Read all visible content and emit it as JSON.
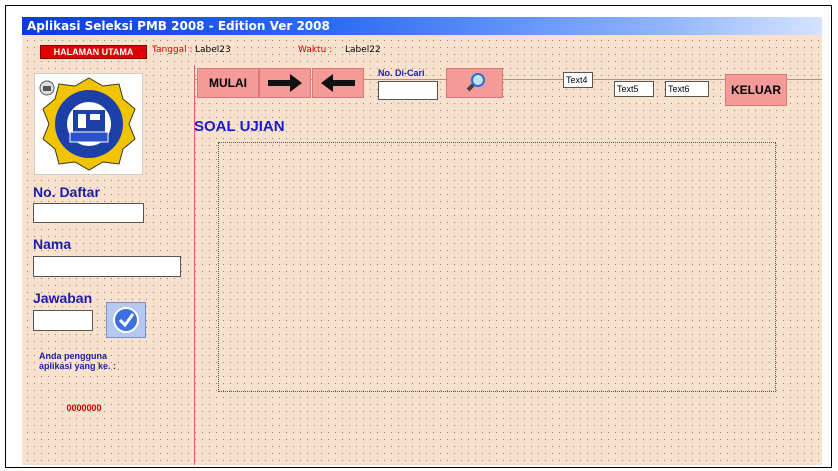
{
  "window": {
    "title": "Aplikasi Seleksi PMB 2008 - Edition Ver 2008"
  },
  "header": {
    "home_button": "HALAMAN UTAMA",
    "tanggal_label": "Tanggal :",
    "tanggal_value": "Label23",
    "waktu_label": "Waktu :",
    "waktu_value": "Label22"
  },
  "toolbar": {
    "mulai_label": "MULAI",
    "next_icon": "arrow-right-icon",
    "prev_icon": "arrow-left-icon",
    "search_label": "No. Di-Cari",
    "search_value": "",
    "search_icon": "magnifier-icon",
    "text4": "Text4",
    "text5": "Text5",
    "text6": "Text6",
    "keluar_label": "KELUAR"
  },
  "sidebar": {
    "logo": "stmik-logo",
    "no_daftar_label": "No. Daftar",
    "no_daftar_value": "",
    "nama_label": "Nama",
    "nama_value": "",
    "jawaban_label": "Jawaban",
    "jawaban_value": "",
    "submit_icon": "checkmark-icon",
    "user_note_line1": "Anda pengguna",
    "user_note_line2": "aplikasi yang ke. :",
    "user_count": "0000000"
  },
  "main": {
    "title": "SOAL UJIAN"
  },
  "colors": {
    "form_bg": "#f8e2cd",
    "button_pink": "#f49a98",
    "label_blue": "#1c1ca8",
    "title_blue": "#0a3cd8",
    "accent_red": "#e00000"
  }
}
